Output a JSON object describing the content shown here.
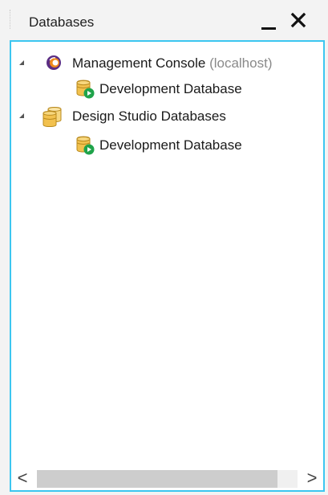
{
  "panel": {
    "title": "Databases",
    "minimize_icon": "minimize-icon",
    "close_icon": "close-icon"
  },
  "tree": {
    "nodes": [
      {
        "label": "Management Console",
        "suffix": "(localhost)",
        "icon": "management-console-icon",
        "expanded": true
      },
      {
        "label": "Development Database",
        "icon": "database-running-icon"
      },
      {
        "label": "Design Studio Databases",
        "icon": "database-group-icon",
        "expanded": true
      },
      {
        "label": "Development Database",
        "icon": "database-running-icon"
      }
    ]
  },
  "scrollbar": {
    "left_arrow": "<",
    "right_arrow": ">"
  },
  "colors": {
    "focus_border": "#3cc6f0",
    "db_yellow": "#f2c14e",
    "run_green": "#1fa34a",
    "console_purple": "#5b2d82",
    "console_orange": "#f08a1c"
  }
}
